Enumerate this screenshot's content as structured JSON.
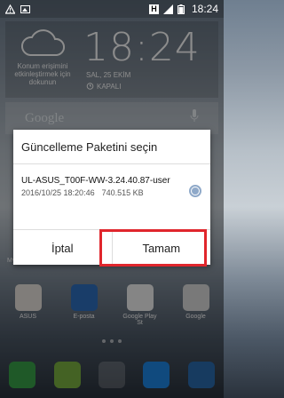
{
  "status_bar": {
    "time": "18:24"
  },
  "clock_widget": {
    "weather_text": "Konum erişimini etkinleştirmek için dokunun",
    "time": "18:24",
    "date": "SAL, 25 EKİM",
    "alarm": "KAPALI"
  },
  "search": {
    "logo": "Google"
  },
  "dialog": {
    "title": "Güncelleme Paketini seçin",
    "option": {
      "name": "UL-ASUS_T00F-WW-3.24.40.87-user",
      "date": "2016/10/25 18:20:46",
      "size": "740.515 KB",
      "selected": true
    },
    "cancel_label": "İptal",
    "ok_label": "Tamam"
  },
  "home": {
    "folder_label": "MyASUS",
    "apps": [
      "ASUS",
      "E-posta",
      "Google Play St",
      "Google"
    ]
  },
  "colors": {
    "highlight": "#e0262c",
    "radio": "#8fa9c9"
  }
}
